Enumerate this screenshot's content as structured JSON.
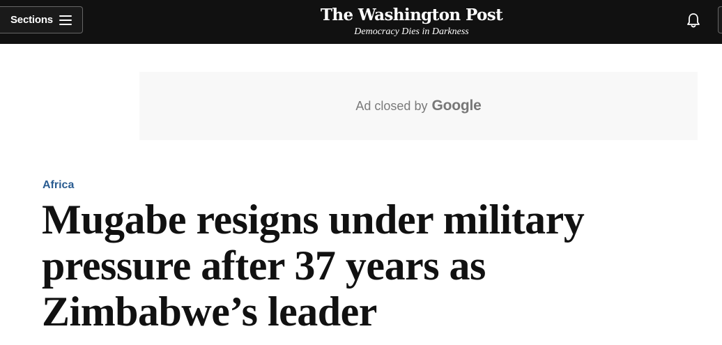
{
  "header": {
    "sections_label": "Sections",
    "logo_text": "The Washington Post",
    "tagline": "Democracy Dies in Darkness"
  },
  "ad": {
    "closed_text": "Ad closed by",
    "brand": "Google"
  },
  "article": {
    "kicker": "Africa",
    "headline": "Mugabe resigns under military pressure after 37 years as Zimbabwe’s leader"
  },
  "colors": {
    "header_bg": "#111111",
    "kicker": "#2a5c91",
    "headline": "#111111",
    "ad_bg": "#f8f8f8"
  },
  "icons": {
    "menu": "hamburger-icon",
    "notifications": "bell-icon"
  }
}
